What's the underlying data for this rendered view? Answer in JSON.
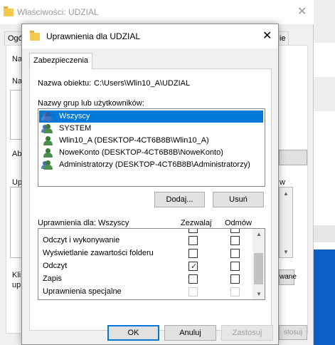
{
  "background_window": {
    "title": "Właściwości: UDZIAL",
    "close_glyph": "✕",
    "tabs": [
      "Ogó",
      "ie"
    ],
    "side_labels": [
      "Na",
      "Na",
      "Ab",
      "Up"
    ],
    "bottom_labels": [
      "Klil",
      "upr"
    ],
    "peek_w": "w",
    "peek_button": "wane",
    "peek_apply": "stosuj"
  },
  "dialog": {
    "title": "Uprawnienia dla UDZIAL",
    "close_glyph": "✕",
    "tab_label": "Zabezpieczenia",
    "object_label": "Nazwa obiektu:",
    "object_value": "C:\\Users\\Wlin10_A\\UDZIAL",
    "groups_label": "Nazwy grup lub użytkowników:",
    "users": [
      {
        "name": "Wszyscy",
        "selected": true,
        "icon": "group-icon"
      },
      {
        "name": "SYSTEM",
        "selected": false,
        "icon": "group-icon"
      },
      {
        "name": "Wlin10_A (DESKTOP-4CT6B8B\\Wlin10_A)",
        "selected": false,
        "icon": "user-icon"
      },
      {
        "name": "NoweKonto (DESKTOP-4CT6B8B\\NoweKonto)",
        "selected": false,
        "icon": "user-icon"
      },
      {
        "name": "Administratorzy (DESKTOP-4CT6B8B\\Administratorzy)",
        "selected": false,
        "icon": "group-icon"
      }
    ],
    "add_button": "Dodaj...",
    "remove_button": "Usuń",
    "permissions_for": "Uprawnienia dla: Wszyscy",
    "allow_header": "Zezwalaj",
    "deny_header": "Odmów",
    "permissions": [
      {
        "name": "Odczyt i wykonywanie",
        "allow": false,
        "deny": false,
        "disabled": false
      },
      {
        "name": "Wyświetlanie zawartości folderu",
        "allow": false,
        "deny": false,
        "disabled": false
      },
      {
        "name": "Odczyt",
        "allow": true,
        "deny": false,
        "disabled": false
      },
      {
        "name": "Zapis",
        "allow": false,
        "deny": false,
        "disabled": false
      },
      {
        "name": "Uprawnienia specjalne",
        "allow": false,
        "deny": false,
        "disabled": true
      }
    ],
    "ok_button": "OK",
    "cancel_button": "Anuluj",
    "apply_button": "Zastosuj"
  },
  "colors": {
    "selection": "#0078d7",
    "folder": "#f4c94d",
    "taskbar_accent": "#0d5fc7"
  }
}
